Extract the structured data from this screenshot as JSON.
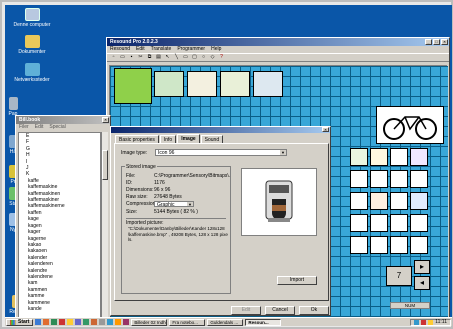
{
  "desktop": {
    "icons": [
      {
        "label": "Denne computer",
        "icon": "computer-icon"
      },
      {
        "label": "Dokumenter",
        "icon": "folder-icon"
      },
      {
        "label": "Netværkssteder",
        "icon": "network-icon"
      },
      {
        "label": "Pap",
        "icon": "recycle-bin-icon"
      },
      {
        "label": "Hå",
        "icon": "shortcut-icon"
      },
      {
        "label": "Pr",
        "icon": "shortcut-icon"
      },
      {
        "label": "Sta",
        "icon": "shortcut-icon"
      },
      {
        "label": "Ny",
        "icon": "shortcut-icon"
      },
      {
        "label": "Resoun",
        "icon": "resound-icon"
      }
    ]
  },
  "resound": {
    "title": "Resound Pro 2.0.2.3",
    "menu": [
      "Resound",
      "Edit",
      "Translate",
      "Programmer",
      "Help"
    ],
    "page_label": "NUM",
    "nav_number": "7"
  },
  "listwin": {
    "title": "Bill.book",
    "menu": [
      "Filer",
      "Edit",
      "Special"
    ],
    "items": [
      {
        "text": "E",
        "letter": true
      },
      {
        "text": "F",
        "letter": true
      },
      {
        "text": "G",
        "letter": true
      },
      {
        "text": "H",
        "letter": true
      },
      {
        "text": "I",
        "letter": true
      },
      {
        "text": "J",
        "letter": true
      },
      {
        "text": "K",
        "letter": true
      },
      {
        "text": "kaffe",
        "letter": false
      },
      {
        "text": "kaffemaskine",
        "letter": false
      },
      {
        "text": "kaffemaskinen",
        "letter": false
      },
      {
        "text": "kaffemaskiner",
        "letter": false
      },
      {
        "text": "kaffemaskinerne",
        "letter": false
      },
      {
        "text": "kaffen",
        "letter": false
      },
      {
        "text": "kage",
        "letter": false
      },
      {
        "text": "kagen",
        "letter": false
      },
      {
        "text": "kager",
        "letter": false
      },
      {
        "text": "kagerne",
        "letter": false
      },
      {
        "text": "kakao",
        "letter": false
      },
      {
        "text": "kakaoen",
        "letter": false
      },
      {
        "text": "kalender",
        "letter": false
      },
      {
        "text": "kalenderen",
        "letter": false
      },
      {
        "text": "kalendre",
        "letter": false
      },
      {
        "text": "kalendrene",
        "letter": false
      },
      {
        "text": "kam",
        "letter": false
      },
      {
        "text": "kammen",
        "letter": false
      },
      {
        "text": "kamme",
        "letter": false
      },
      {
        "text": "kammene",
        "letter": false
      },
      {
        "text": "kande",
        "letter": false
      }
    ]
  },
  "props": {
    "tabs": [
      "Basic properties",
      "Info",
      "Image",
      "Sound"
    ],
    "active_tab": "Image",
    "image_type_label": "Image type:",
    "image_type_value": "Icon 96",
    "stored_image_title": "Stored image",
    "fields": [
      {
        "k": "File:",
        "v": "C:\\Programmer\\Sensory\\Bitmaps\\..."
      },
      {
        "k": "ID:",
        "v": "1176"
      },
      {
        "k": "Dimensions:",
        "v": "96 x 96"
      },
      {
        "k": "Raw size:",
        "v": "27648 Bytes"
      },
      {
        "k": "Compression:",
        "v": "Graphic"
      },
      {
        "k": "Size:",
        "v": "5144 Bytes ( 82 % )"
      }
    ],
    "imported_label": "Imported picture:",
    "imported_text": "\"C:\\Dokumenter\\Danby\\Billeder\\Kander 128x128\\kaffemaskine.bmp\" , 49208 Bytes, 128 x 128 pixels.",
    "buttons": {
      "import": "Import",
      "edit": "Edit",
      "cancel": "Cancel",
      "ok": "Ok"
    }
  },
  "taskbar": {
    "start": "Start",
    "tasks": [
      "Billeder 02 Indhold",
      "Fra notebo...",
      "Guldendals ...",
      "Resoun..."
    ],
    "active_task": "Resoun...",
    "clock": "11:11"
  },
  "colors": {
    "desktop": "#0a56a8",
    "title_active": "#0a246a",
    "grid": "#39a7d8",
    "grid_line": "#0a5d86"
  }
}
